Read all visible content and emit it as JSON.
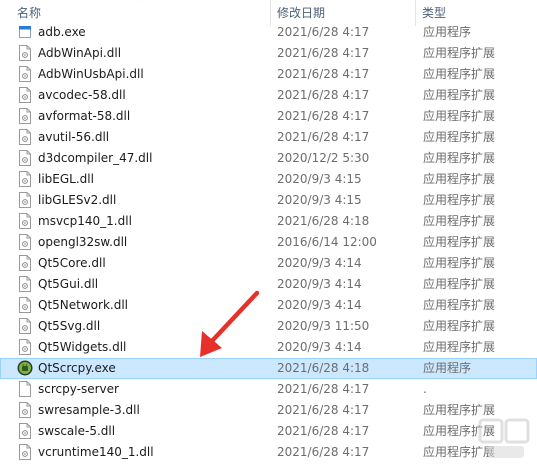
{
  "columns": {
    "name": "名称",
    "date": "修改日期",
    "type": "类型"
  },
  "accent_selected": "#cce8ff",
  "arrow_color": "#e8302a",
  "files": [
    {
      "name": "adb.exe",
      "date": "2021/6/28 4:17",
      "type": "应用程序",
      "icon": "exe-file-icon"
    },
    {
      "name": "AdbWinApi.dll",
      "date": "2021/6/28 4:17",
      "type": "应用程序扩展",
      "icon": "dll-file-icon"
    },
    {
      "name": "AdbWinUsbApi.dll",
      "date": "2021/6/28 4:17",
      "type": "应用程序扩展",
      "icon": "dll-file-icon"
    },
    {
      "name": "avcodec-58.dll",
      "date": "2021/6/28 4:17",
      "type": "应用程序扩展",
      "icon": "dll-file-icon"
    },
    {
      "name": "avformat-58.dll",
      "date": "2021/6/28 4:17",
      "type": "应用程序扩展",
      "icon": "dll-file-icon"
    },
    {
      "name": "avutil-56.dll",
      "date": "2021/6/28 4:17",
      "type": "应用程序扩展",
      "icon": "dll-file-icon"
    },
    {
      "name": "d3dcompiler_47.dll",
      "date": "2020/12/2 5:30",
      "type": "应用程序扩展",
      "icon": "dll-file-icon"
    },
    {
      "name": "libEGL.dll",
      "date": "2020/9/3 4:15",
      "type": "应用程序扩展",
      "icon": "dll-file-icon"
    },
    {
      "name": "libGLESv2.dll",
      "date": "2020/9/3 4:15",
      "type": "应用程序扩展",
      "icon": "dll-file-icon"
    },
    {
      "name": "msvcp140_1.dll",
      "date": "2021/6/28 4:18",
      "type": "应用程序扩展",
      "icon": "dll-file-icon"
    },
    {
      "name": "opengl32sw.dll",
      "date": "2016/6/14 12:00",
      "type": "应用程序扩展",
      "icon": "dll-file-icon"
    },
    {
      "name": "Qt5Core.dll",
      "date": "2020/9/3 4:14",
      "type": "应用程序扩展",
      "icon": "dll-file-icon"
    },
    {
      "name": "Qt5Gui.dll",
      "date": "2020/9/3 4:14",
      "type": "应用程序扩展",
      "icon": "dll-file-icon"
    },
    {
      "name": "Qt5Network.dll",
      "date": "2020/9/3 4:14",
      "type": "应用程序扩展",
      "icon": "dll-file-icon"
    },
    {
      "name": "Qt5Svg.dll",
      "date": "2020/9/3 11:50",
      "type": "应用程序扩展",
      "icon": "dll-file-icon"
    },
    {
      "name": "Qt5Widgets.dll",
      "date": "2020/9/3 4:14",
      "type": "应用程序扩展",
      "icon": "dll-file-icon"
    },
    {
      "name": "QtScrcpy.exe",
      "date": "2021/6/28 4:18",
      "type": "应用程序",
      "icon": "qtscrcpy-app-icon",
      "selected": true
    },
    {
      "name": "scrcpy-server",
      "date": "2021/6/28 4:17",
      "type": ".",
      "icon": "blank-file-icon"
    },
    {
      "name": "swresample-3.dll",
      "date": "2021/6/28 4:17",
      "type": "应用程序扩展",
      "icon": "dll-file-icon"
    },
    {
      "name": "swscale-5.dll",
      "date": "2021/6/28 4:17",
      "type": "应用程序扩展",
      "icon": "dll-file-icon"
    },
    {
      "name": "vcruntime140_1.dll",
      "date": "2021/6/28 4:17",
      "type": "应用程序扩展",
      "icon": "dll-file-icon"
    }
  ]
}
